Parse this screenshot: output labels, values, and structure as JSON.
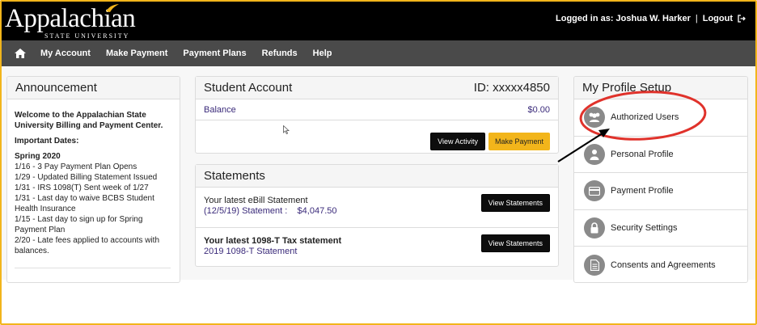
{
  "header": {
    "logo": {
      "name": "Appalachian",
      "subtitle": "STATE UNIVERSITY"
    },
    "login_text": "Logged in as: Joshua W. Harker",
    "separator": "|",
    "logout_label": "Logout"
  },
  "nav": {
    "items": [
      {
        "label": "My Account"
      },
      {
        "label": "Make Payment"
      },
      {
        "label": "Payment Plans"
      },
      {
        "label": "Refunds"
      },
      {
        "label": "Help"
      }
    ]
  },
  "announcement": {
    "title": "Announcement",
    "welcome": "Welcome to the Appalachian State University Billing and Payment Center.",
    "important": "Important Dates:",
    "term": "Spring 2020",
    "dates": [
      "1/16 - 3 Pay Payment Plan Opens",
      "1/29 - Updated Billing Statement Issued",
      "1/31 - IRS 1098(T) Sent week of 1/27",
      "1/31 - Last day to waive BCBS Student Health Insurance",
      "1/15 - Last day to sign up for Spring Payment Plan",
      "2/20 - Late fees applied to accounts with balances."
    ]
  },
  "student_account": {
    "title": "Student Account",
    "id_text": "ID: xxxxx4850",
    "balance_label": "Balance",
    "balance_value": "$0.00",
    "view_activity": "View Activity",
    "make_payment": "Make Payment"
  },
  "statements": {
    "title": "Statements",
    "ebill_title": "Your latest eBill Statement",
    "ebill_sub": "(12/5/19) Statement :    $4,047.50",
    "tax_title": "Your latest 1098-T Tax statement",
    "tax_sub": "2019 1098-T Statement",
    "view_statements": "View Statements"
  },
  "profile": {
    "title": "My Profile Setup",
    "items": [
      {
        "label": "Authorized Users",
        "icon": "users-icon"
      },
      {
        "label": "Personal Profile",
        "icon": "person-icon"
      },
      {
        "label": "Payment Profile",
        "icon": "credit-card-icon"
      },
      {
        "label": "Security Settings",
        "icon": "lock-icon"
      },
      {
        "label": "Consents and Agreements",
        "icon": "document-icon"
      }
    ]
  },
  "colors": {
    "accent_gold": "#f2b51b",
    "topbar": "#000000",
    "navbar": "#4a4a4a",
    "link_purple": "#3a2a7a",
    "annotation_red": "#e0322b"
  }
}
